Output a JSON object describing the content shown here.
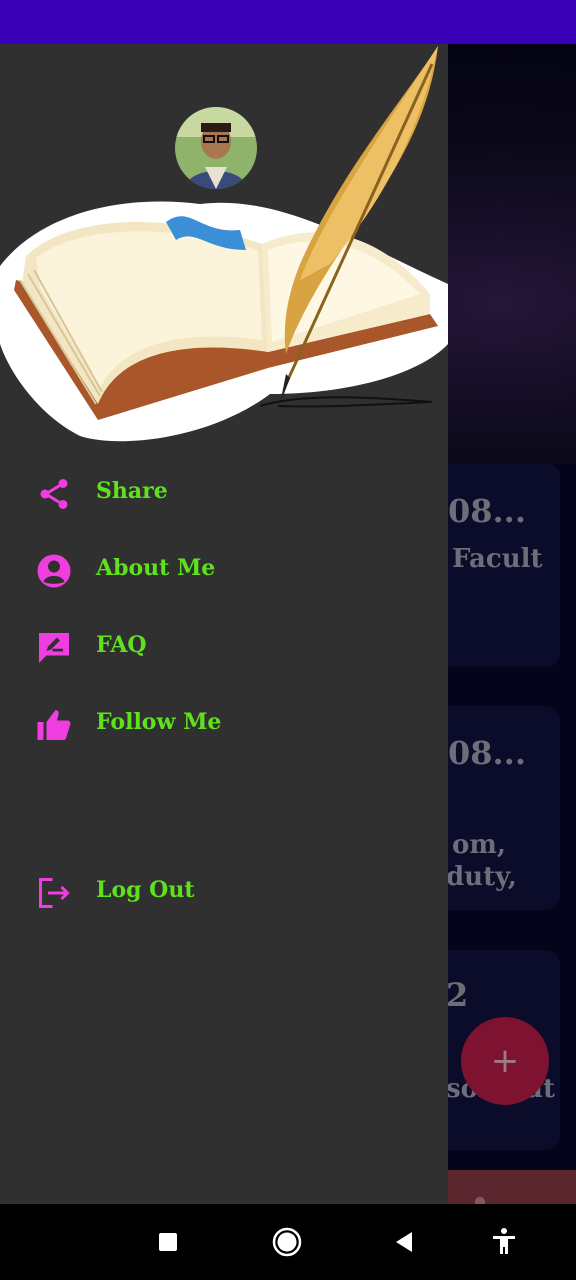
{
  "drawer": {
    "menu": [
      {
        "label": "Share",
        "icon": "share-icon"
      },
      {
        "label": "About Me",
        "icon": "account-circle-icon"
      },
      {
        "label": "FAQ",
        "icon": "rate-review-icon"
      },
      {
        "label": "Follow Me",
        "icon": "thumb-up-icon"
      },
      {
        "label": "Log Out",
        "icon": "logout-icon"
      }
    ]
  },
  "background": {
    "card1": {
      "title": "08...",
      "text": "Facult"
    },
    "card2": {
      "title": "08...",
      "line1": "om,",
      "line2": "duty,"
    },
    "card3": {
      "title": "2",
      "line1": "son but"
    },
    "fab_label": "+"
  },
  "colors": {
    "status_bar": "#3a00b8",
    "drawer_bg": "#303030",
    "menu_text": "#5fe21d",
    "menu_icon": "#f03de0"
  }
}
